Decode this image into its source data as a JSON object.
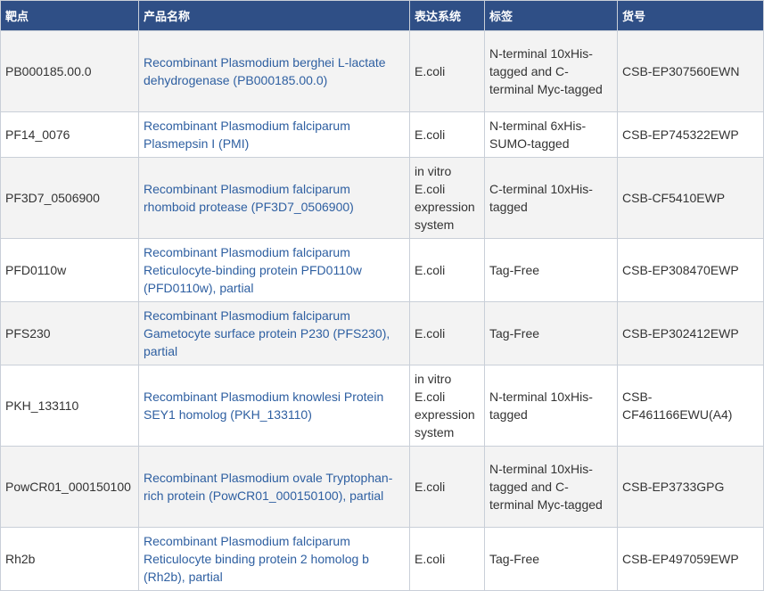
{
  "headers": {
    "target": "靶点",
    "product_name": "产品名称",
    "expression_system": "表达系统",
    "tag": "标签",
    "catalog": "货号"
  },
  "rows": [
    {
      "target": "PB000185.00.0",
      "product_name": "Recombinant Plasmodium berghei L-lactate dehydrogenase (PB000185.00.0)",
      "expression_system": "E.coli",
      "tag": "N-terminal 10xHis-tagged and C-terminal Myc-tagged",
      "catalog": "CSB-EP307560EWN"
    },
    {
      "target": "PF14_0076",
      "product_name": "Recombinant Plasmodium falciparum Plasmepsin I (PMI)",
      "expression_system": "E.coli",
      "tag": "N-terminal 6xHis-SUMO-tagged",
      "catalog": "CSB-EP745322EWP"
    },
    {
      "target": "PF3D7_0506900",
      "product_name": "Recombinant Plasmodium falciparum rhomboid protease (PF3D7_0506900)",
      "expression_system": "in vitro E.coli expression system",
      "tag": "C-terminal 10xHis-tagged",
      "catalog": "CSB-CF5410EWP"
    },
    {
      "target": "PFD0110w",
      "product_name": "Recombinant Plasmodium falciparum Reticulocyte-binding protein PFD0110w (PFD0110w), partial",
      "expression_system": "E.coli",
      "tag": "Tag-Free",
      "catalog": "CSB-EP308470EWP"
    },
    {
      "target": "PFS230",
      "product_name": "Recombinant Plasmodium falciparum Gametocyte surface protein P230 (PFS230), partial",
      "expression_system": "E.coli",
      "tag": "Tag-Free",
      "catalog": "CSB-EP302412EWP"
    },
    {
      "target": "PKH_133110",
      "product_name": "Recombinant Plasmodium knowlesi Protein SEY1 homolog (PKH_133110)",
      "expression_system": "in vitro E.coli expression system",
      "tag": "N-terminal 10xHis-tagged",
      "catalog": "CSB-CF461166EWU(A4)"
    },
    {
      "target": "PowCR01_000150100",
      "product_name": "Recombinant Plasmodium ovale Tryptophan-rich protein (PowCR01_000150100), partial",
      "expression_system": "E.coli",
      "tag": "N-terminal 10xHis-tagged and C-terminal Myc-tagged",
      "catalog": "CSB-EP3733GPG"
    },
    {
      "target": "Rh2b",
      "product_name": "Recombinant Plasmodium falciparum Reticulocyte binding protein 2 homolog b (Rh2b), partial",
      "expression_system": "E.coli",
      "tag": "Tag-Free",
      "catalog": "CSB-EP497059EWP"
    }
  ],
  "colors": {
    "header_bg": "#2f4f86",
    "link": "#2e5fa1",
    "row_alt": "#f3f3f3",
    "border": "#c9cfd8"
  }
}
